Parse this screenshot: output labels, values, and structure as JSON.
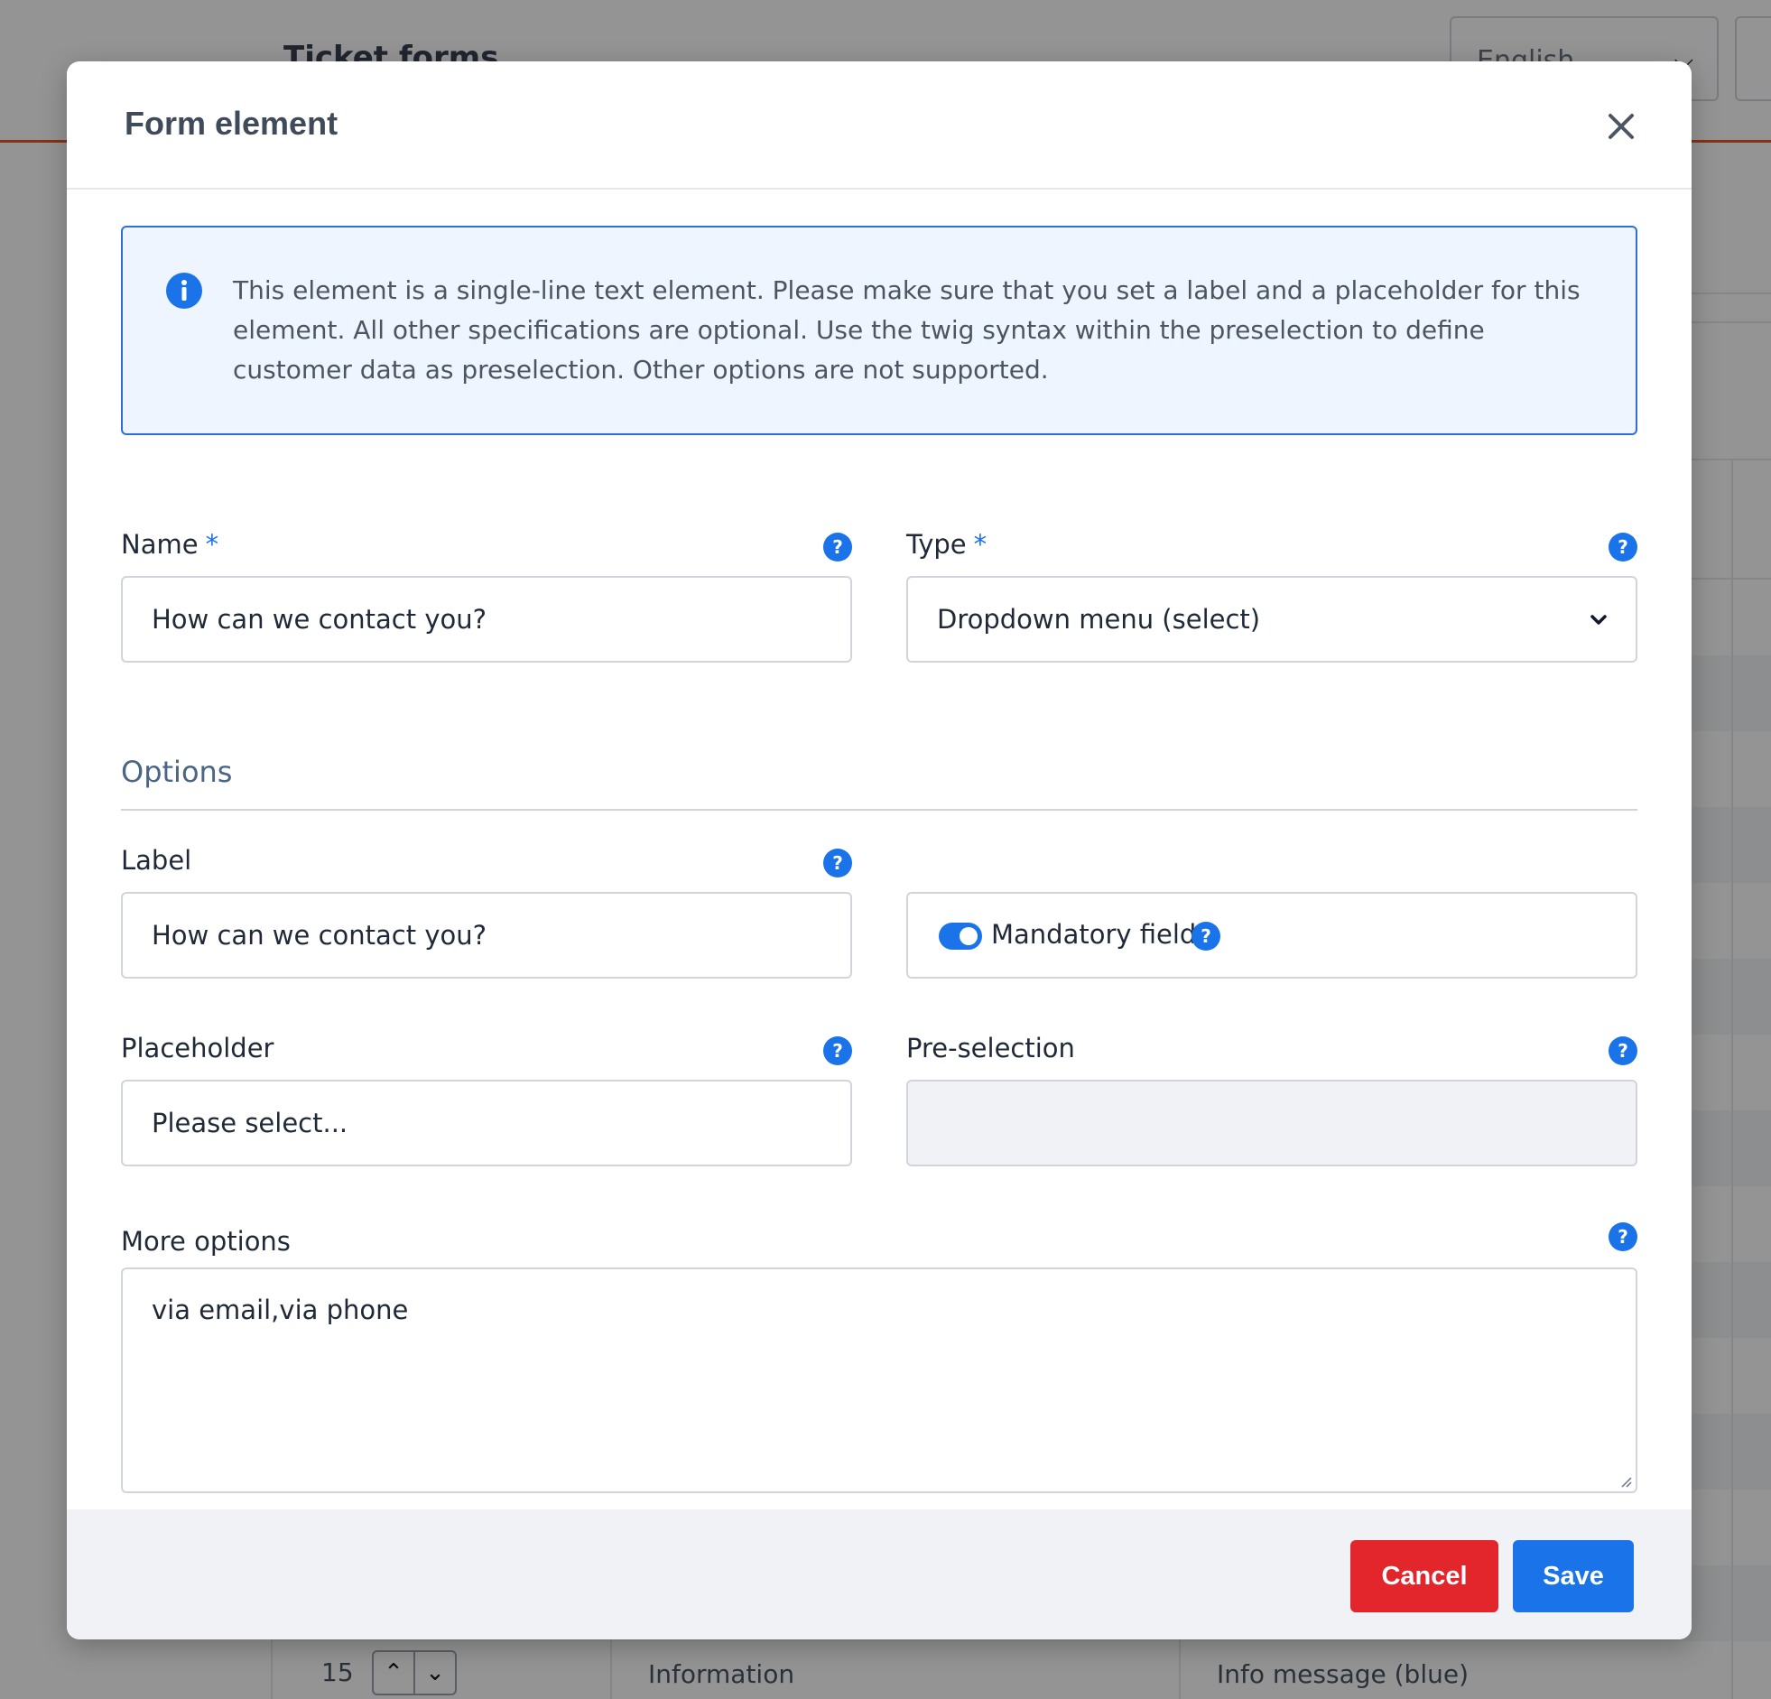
{
  "background": {
    "page_title": "Ticket forms",
    "language_select": "English",
    "visible_row": {
      "number": "15",
      "type": "Information",
      "message": "Info message (blue)"
    }
  },
  "modal": {
    "title": "Form element",
    "info_text": "This element is a single-line text element. Please make sure that you set a label and a placeholder for this element. All other specifications are optional. Use the twig syntax within the preselection to define customer data as preselection. Other options are not supported.",
    "fields": {
      "name": {
        "label": "Name",
        "required_mark": "*",
        "value": "How can we contact you?"
      },
      "type": {
        "label": "Type",
        "required_mark": "*",
        "value": "Dropdown menu (select)"
      }
    },
    "options_section": {
      "title": "Options",
      "label_field": {
        "label": "Label",
        "value": "How can we contact you?"
      },
      "mandatory": {
        "label": "Mandatory field",
        "enabled": true
      },
      "placeholder_field": {
        "label": "Placeholder",
        "value": "Please select..."
      },
      "preselection_field": {
        "label": "Pre-selection",
        "value": ""
      },
      "more_options": {
        "label": "More options",
        "value": "via email,via phone"
      }
    },
    "help_icon_glyph": "?",
    "footer": {
      "cancel_label": "Cancel",
      "save_label": "Save"
    }
  },
  "colors": {
    "primary": "#1a73e8",
    "danger": "#e3262b",
    "info_bg": "#eef5ff",
    "info_border": "#2f6fdb",
    "header_accent": "#e4572e"
  }
}
